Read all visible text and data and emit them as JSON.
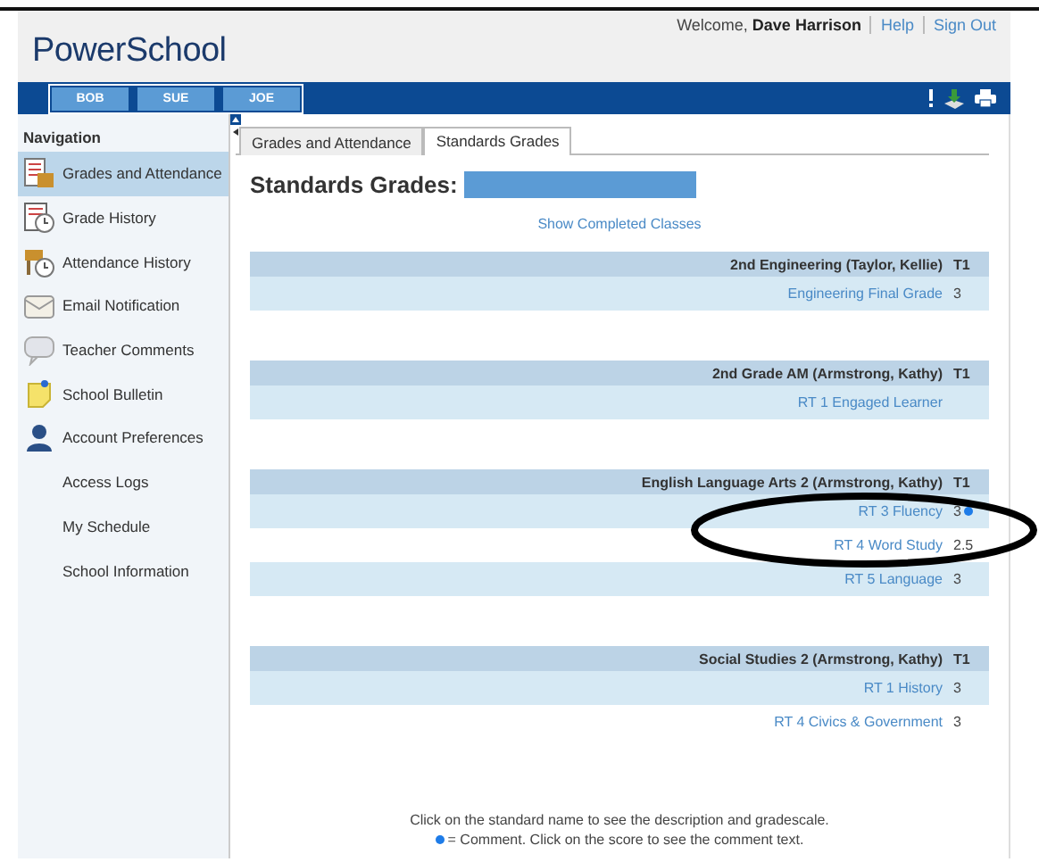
{
  "header": {
    "logo": "PowerSchool",
    "welcome": "Welcome,",
    "user": "Dave Harrison",
    "links": [
      "Help",
      "Sign Out"
    ]
  },
  "students": [
    {
      "name": "BOB"
    },
    {
      "name": "SUE"
    },
    {
      "name": "JOE"
    }
  ],
  "sidebar": {
    "title": "Navigation",
    "items": [
      {
        "label": "Grades and Attendance",
        "kind": "grades",
        "selected": true
      },
      {
        "label": "Grade History",
        "kind": "history",
        "selected": false
      },
      {
        "label": "Attendance History",
        "kind": "attendance",
        "selected": false
      },
      {
        "label": "Email Notification",
        "kind": "email",
        "selected": false
      },
      {
        "label": "Teacher Comments",
        "kind": "comments",
        "selected": false
      },
      {
        "label": "School Bulletin",
        "kind": "bulletin",
        "selected": false
      },
      {
        "label": "Account Preferences",
        "kind": "account",
        "selected": false
      },
      {
        "label": "Access Logs",
        "kind": "plain",
        "selected": false
      },
      {
        "label": "My Schedule",
        "kind": "plain",
        "selected": false
      },
      {
        "label": "School Information",
        "kind": "plain",
        "selected": false
      }
    ]
  },
  "tabs": [
    {
      "label": "Grades and Attendance",
      "selected": false
    },
    {
      "label": "Standards Grades",
      "selected": true
    }
  ],
  "heading": "Standards Grades:",
  "show_completed": "Show Completed Classes",
  "courses": [
    {
      "name": "2nd Engineering (Taylor, Kellie)",
      "term": "T1",
      "standards": [
        {
          "name": "Engineering Final Grade",
          "score": "3",
          "comment": false
        }
      ]
    },
    {
      "name": "2nd Grade AM (Armstrong, Kathy)",
      "term": "T1",
      "standards": [
        {
          "name": "RT 1 Engaged Learner",
          "comment": false
        }
      ]
    },
    {
      "name": "English Language Arts 2 (Armstrong, Kathy)",
      "term": "T1",
      "standards": [
        {
          "name": "RT 3 Fluency",
          "score": "3",
          "comment": true
        },
        {
          "name": "RT 4 Word Study",
          "score": "2.5",
          "comment": false
        },
        {
          "name": "RT 5 Language",
          "score": "3",
          "comment": false
        }
      ]
    },
    {
      "name": "Social Studies 2 (Armstrong, Kathy)",
      "term": "T1",
      "standards": [
        {
          "name": "RT 1 History",
          "score": "3",
          "comment": false
        },
        {
          "name": "RT 4 Civics & Government",
          "score": "3",
          "comment": false
        }
      ]
    }
  ],
  "footer": [
    "Click on the standard name to see the description and gradescale.",
    "= Comment. Click on the score to see the comment text."
  ]
}
